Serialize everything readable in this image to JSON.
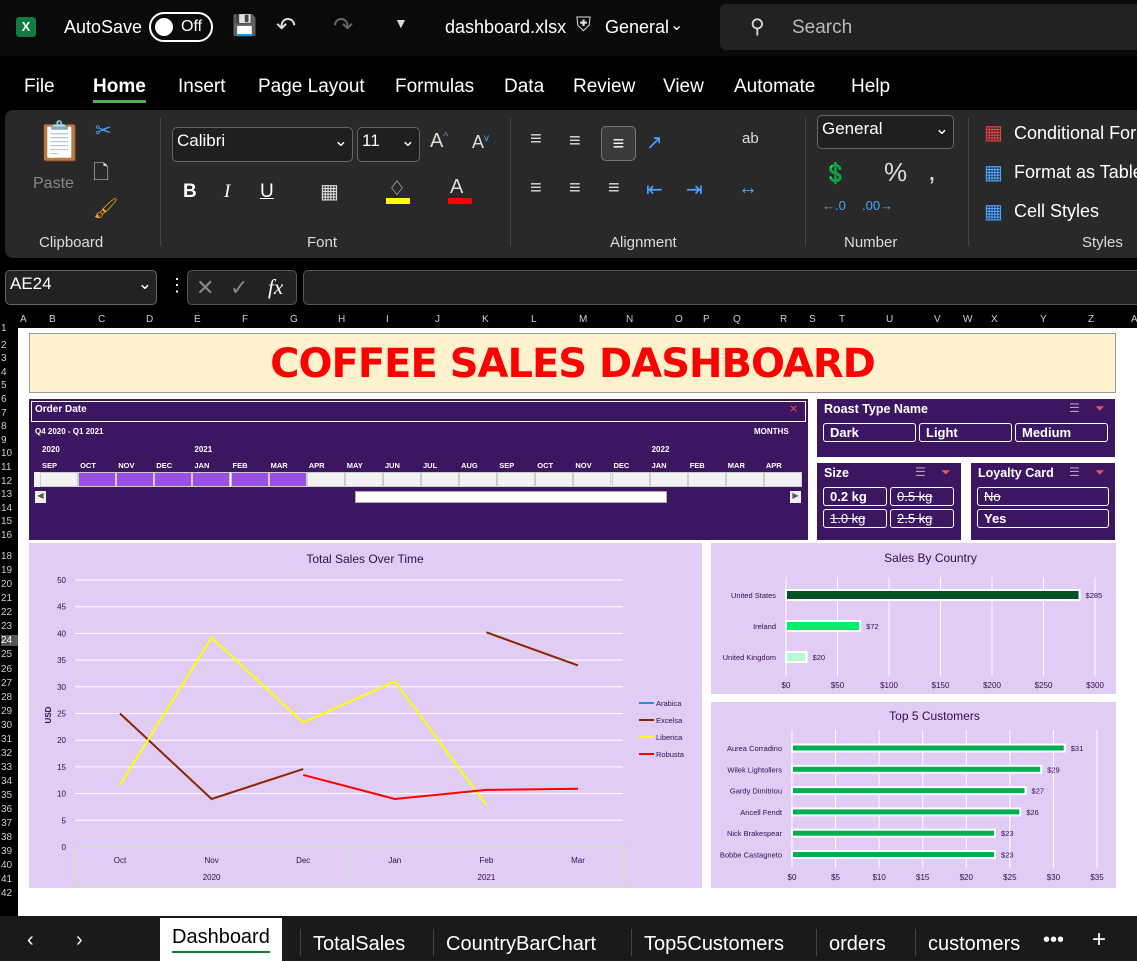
{
  "titlebar": {
    "autosave_label": "AutoSave",
    "autosave_state": "Off",
    "filename": "dashboard.xlsx",
    "sensitivity": "General",
    "search_placeholder": "Search"
  },
  "menu": [
    "File",
    "Home",
    "Insert",
    "Page Layout",
    "Formulas",
    "Data",
    "Review",
    "View",
    "Automate",
    "Help"
  ],
  "active_menu": "Home",
  "ribbon": {
    "clipboard": {
      "paste": "Paste",
      "label": "Clipboard"
    },
    "font": {
      "family": "Calibri",
      "size": "11",
      "label": "Font",
      "bold": "B",
      "italic": "I",
      "underline": "U",
      "highlight_color": "#ffff00",
      "font_color": "#ff0000"
    },
    "alignment": {
      "label": "Alignment"
    },
    "number": {
      "format": "General",
      "label": "Number"
    },
    "styles": {
      "conditional": "Conditional For",
      "format_table": "Format as Table",
      "cell_styles": "Cell Styles",
      "label": "Styles"
    }
  },
  "formula_bar": {
    "name_box": "AE24",
    "fx": "fx",
    "value": ""
  },
  "columns": [
    "A",
    "B",
    "C",
    "D",
    "E",
    "F",
    "G",
    "H",
    "I",
    "J",
    "K",
    "L",
    "M",
    "N",
    "O",
    "P",
    "Q",
    "R",
    "S",
    "T",
    "U",
    "V",
    "W",
    "X",
    "Y",
    "Z",
    "A"
  ],
  "rows": [
    "1",
    "2",
    "3",
    "4",
    "5",
    "6",
    "7",
    "8",
    "9",
    "10",
    "11",
    "12",
    "13",
    "14",
    "15",
    "16",
    "18",
    "19",
    "20",
    "21",
    "22",
    "23",
    "24",
    "25",
    "26",
    "27",
    "28",
    "29",
    "30",
    "31",
    "32",
    "33",
    "34",
    "35",
    "36",
    "37",
    "38",
    "39",
    "40",
    "41",
    "42"
  ],
  "active_row": "24",
  "dashboard": {
    "title": "COFFEE SALES DASHBOARD",
    "title_color": "#ff0000",
    "title_bg": "#fff2cc",
    "panel_color": "#3c1661",
    "chart_bg": "#e0ccf5"
  },
  "timeline": {
    "header": "Order Date",
    "range": "Q4 2020 - Q1 2021",
    "level": "MONTHS",
    "years": [
      {
        "label": "2020",
        "index": 0
      },
      {
        "label": "2021",
        "index": 4
      },
      {
        "label": "2022",
        "index": 16
      }
    ],
    "months": [
      "SEP",
      "OCT",
      "NOV",
      "DEC",
      "JAN",
      "FEB",
      "MAR",
      "APR",
      "MAY",
      "JUN",
      "JUL",
      "AUG",
      "SEP",
      "OCT",
      "NOV",
      "DEC",
      "JAN",
      "FEB",
      "MAR",
      "APR"
    ],
    "selected": [
      1,
      2,
      3,
      4,
      5,
      6
    ],
    "selected_color": "#9b4fe0"
  },
  "slicers": {
    "roast": {
      "title": "Roast Type Name",
      "items": [
        {
          "label": "Dark",
          "available": true
        },
        {
          "label": "Light",
          "available": true
        },
        {
          "label": "Medium",
          "available": true
        }
      ]
    },
    "size": {
      "title": "Size",
      "items": [
        {
          "label": "0.2 kg",
          "available": true
        },
        {
          "label": "0.5 kg",
          "available": false
        },
        {
          "label": "1.0 kg",
          "available": false
        },
        {
          "label": "2.5 kg",
          "available": false
        }
      ]
    },
    "loyalty": {
      "title": "Loyalty Card",
      "items": [
        {
          "label": "No",
          "available": false
        },
        {
          "label": "Yes",
          "available": true
        }
      ]
    }
  },
  "chart_data": [
    {
      "type": "line",
      "title": "Total Sales Over Time",
      "ylabel": "USD",
      "xlabel": "",
      "ylim": [
        0,
        50
      ],
      "yticks": [
        0,
        5,
        10,
        15,
        20,
        25,
        30,
        35,
        40,
        45,
        50
      ],
      "categories": [
        "Oct",
        "Nov",
        "Dec",
        "Jan",
        "Feb",
        "Mar"
      ],
      "year_groups": [
        {
          "label": "2020",
          "span": 3
        },
        {
          "label": "2021",
          "span": 3
        }
      ],
      "legend": "right",
      "grid": true,
      "series": [
        {
          "name": "Arabica",
          "color": "#1e90e0",
          "values": [
            null,
            null,
            null,
            null,
            null,
            null
          ]
        },
        {
          "name": "Excelsa",
          "color": "#8b2500",
          "values": [
            25,
            9,
            14.6,
            null,
            40.2,
            34
          ]
        },
        {
          "name": "Liberica",
          "color": "#ffff00",
          "values": [
            11.6,
            39.2,
            23.3,
            31,
            7.8,
            null
          ]
        },
        {
          "name": "Robusta",
          "color": "#ff0000",
          "values": [
            null,
            null,
            13.5,
            9,
            10.7,
            10.9
          ]
        }
      ]
    },
    {
      "type": "bar",
      "orientation": "horizontal",
      "title": "Sales By Country",
      "xlim": [
        0,
        300
      ],
      "xticks": [
        "$0",
        "$50",
        "$100",
        "$150",
        "$200",
        "$250",
        "$300"
      ],
      "grid": true,
      "categories": [
        "United States",
        "Ireland",
        "United Kingdom"
      ],
      "values": [
        285,
        72,
        20
      ],
      "labels": [
        "$285",
        "$72",
        "$20"
      ],
      "colors": [
        "#005225",
        "#00ee6a",
        "#b4fcd4"
      ]
    },
    {
      "type": "bar",
      "orientation": "horizontal",
      "title": "Top 5 Customers",
      "xlim": [
        0,
        35
      ],
      "xticks": [
        "$0",
        "$5",
        "$10",
        "$15",
        "$20",
        "$25",
        "$30",
        "$35"
      ],
      "grid": true,
      "categories": [
        "Aurea Corradino",
        "Wilek Lightollers",
        "Gardy Dimitriou",
        "Ancell Fendt",
        "Nick Brakespear",
        "Bobbe Castagneto"
      ],
      "values": [
        31.3,
        28.6,
        26.8,
        26.2,
        23.3,
        23.3
      ],
      "labels": [
        "$31",
        "$29",
        "$27",
        "$26",
        "$23",
        "$23"
      ],
      "colors": [
        "#00b050"
      ]
    }
  ],
  "sheet_tabs": [
    "Dashboard",
    "TotalSales",
    "CountryBarChart",
    "Top5Customers",
    "orders",
    "customers"
  ],
  "active_tab": "Dashboard",
  "icons": [
    "excel-icon",
    "save-icon",
    "undo-icon",
    "redo-icon",
    "customize-icon",
    "shield-icon",
    "search-icon",
    "paste-icon",
    "cut-icon",
    "copy-icon",
    "format-painter-icon",
    "filter-clear-icon",
    "multiselect-icon"
  ]
}
